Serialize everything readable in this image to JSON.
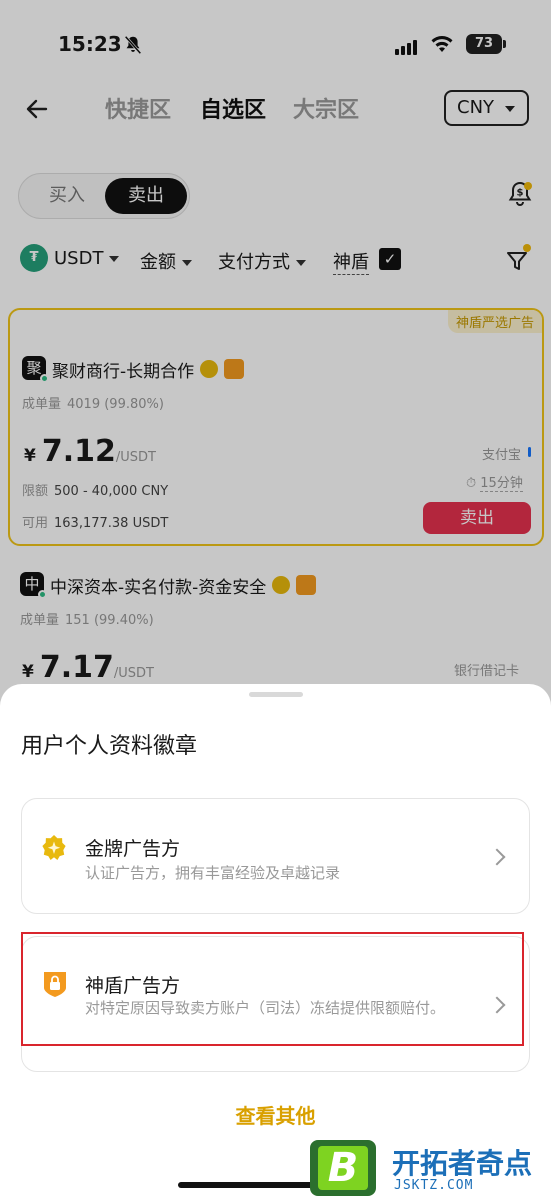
{
  "status_bar": {
    "time": "15:23",
    "battery": "73"
  },
  "nav": {
    "tabs": [
      {
        "label": "快捷区",
        "active": false
      },
      {
        "label": "自选区",
        "active": true
      },
      {
        "label": "大宗区",
        "active": false
      }
    ],
    "currency": "CNY"
  },
  "trade_toggle": {
    "buy": "买入",
    "sell": "卖出",
    "selected": "卖出"
  },
  "filters": {
    "coin": "USDT",
    "coin_icon": "₮",
    "amount": "金额",
    "payment": "支付方式",
    "shield": "神盾",
    "shield_checked": true
  },
  "ads": [
    {
      "ribbon": "神盾严选广告",
      "avatar": "聚",
      "merchant": "聚财商行-长期合作",
      "orders_label": "成单量",
      "orders": "4019 (99.80%)",
      "currency_symbol": "¥",
      "price": "7.12",
      "unit": "/USDT",
      "limit_label": "限额",
      "limit": "500 - 40,000 CNY",
      "available_label": "可用",
      "available": "163,177.38 USDT",
      "payment": "支付宝",
      "time": "15分钟",
      "action": "卖出"
    },
    {
      "avatar": "中",
      "merchant": "中深资本-实名付款-资金安全",
      "orders_label": "成单量",
      "orders": "151 (99.40%)",
      "currency_symbol": "¥",
      "price": "7.17",
      "unit": "/USDT",
      "payment": "银行借记卡"
    }
  ],
  "sheet": {
    "title": "用户个人资料徽章",
    "badges": [
      {
        "name": "金牌广告方",
        "desc": "认证广告方，拥有丰富经验及卓越记录",
        "icon": "gold-star-badge-icon"
      },
      {
        "name": "神盾广告方",
        "desc": "对特定原因导致卖方账户（司法）冻结提供限额赔付。",
        "icon": "shield-lock-badge-icon"
      }
    ],
    "view_more": "查看其他"
  },
  "watermark": {
    "logo_letter": "B",
    "name": "开拓者奇点",
    "url": "JSKTZ.COM"
  },
  "colors": {
    "accent": "#f0b90b",
    "sell": "#e6314f",
    "highlight": "#d9252d",
    "link": "#d9a000"
  }
}
